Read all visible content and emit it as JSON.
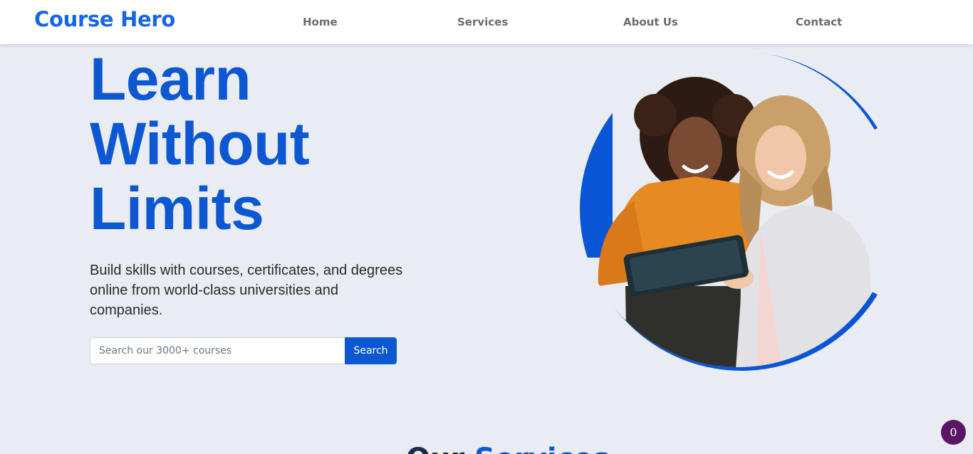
{
  "brand": {
    "name": "Course Hero"
  },
  "nav": {
    "items": [
      {
        "label": "Home"
      },
      {
        "label": "Services"
      },
      {
        "label": "About Us"
      },
      {
        "label": "Contact"
      }
    ]
  },
  "hero": {
    "title_lines": [
      "Learn",
      "Without",
      "Limits"
    ],
    "subtitle": "Build skills with courses, certificates, and degrees online from world-class universities and companies.",
    "search": {
      "placeholder": "Search our 3000+ courses",
      "value": "",
      "button_label": "Search"
    },
    "image": {
      "description_icon": "two-women-with-tablet-image"
    }
  },
  "next_section": {
    "title_start": "Our ",
    "title_accent": "Services"
  },
  "badge": {
    "count": "0"
  },
  "colors": {
    "brand": "#1565e8",
    "accent": "#0d58d2",
    "background": "#e9ecf2",
    "badge": "#5c1563"
  }
}
